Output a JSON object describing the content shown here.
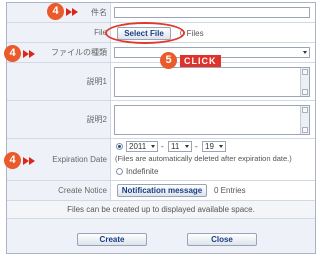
{
  "rows": {
    "subject": {
      "label": "件名",
      "value": ""
    },
    "file": {
      "label": "File",
      "button": "Select File",
      "count": "0 Files"
    },
    "file_type": {
      "label": "ファイルの種類",
      "value": ""
    },
    "desc1": {
      "label": "説明1",
      "value": ""
    },
    "desc2": {
      "label": "説明2",
      "value": ""
    },
    "expiration": {
      "label": "Expiration Date",
      "year": "2011",
      "month": "11",
      "day": "19",
      "sep1": "-",
      "sep2": "-",
      "note": "(Files are automatically deleted after expiration date.)",
      "indefinite": "Indefinite"
    },
    "notice": {
      "label": "Create Notice",
      "button": "Notification message",
      "count": "0 Entries"
    }
  },
  "info": "Files can be created up to displayed available space.",
  "actions": {
    "create": "Create",
    "close": "Close"
  },
  "callouts": {
    "step4": "4",
    "step5": "5",
    "click": "CLICK"
  },
  "colors": {
    "badge": "#ea5a2b",
    "arrow": "#d9281a",
    "highlight": "#e03a2a",
    "button_text": "#1a3f86",
    "label_bg": "#eef2f8"
  }
}
